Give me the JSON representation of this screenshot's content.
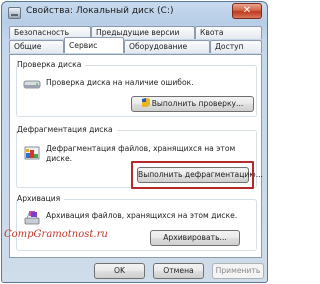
{
  "window": {
    "title": "Свойства: Локальный диск (C:)",
    "close_glyph": "✕"
  },
  "tabs": {
    "row_back": [
      "Безопасность",
      "Предыдущие версии",
      "Квота"
    ],
    "row_front": [
      "Общие",
      "Сервис",
      "Оборудование",
      "Доступ"
    ],
    "active": "Сервис"
  },
  "check": {
    "title": "Проверка диска",
    "text": "Проверка диска на наличие ошибок.",
    "button": "Выполнить проверку..."
  },
  "defrag": {
    "title": "Дефрагментация диска",
    "text": "Дефрагментация файлов, хранящихся на этом диске.",
    "button": "Выполнить дефрагментацию..."
  },
  "archive": {
    "title": "Архивация",
    "text": "Архивация файлов, хранящихся на этом диске.",
    "button": "Архивировать..."
  },
  "footer": {
    "ok": "OK",
    "cancel": "Отмена",
    "apply": "Применить"
  },
  "watermark": "CompGramotnost.ru",
  "colors": {
    "highlight_outline": "#b52a2a",
    "watermark": "#c0392b",
    "shield_blue": "#2a5db0",
    "shield_yellow": "#e8b81e"
  },
  "icons": [
    "drive-icon",
    "shield-icon",
    "defrag-icon",
    "backup-icon",
    "close-icon"
  ]
}
